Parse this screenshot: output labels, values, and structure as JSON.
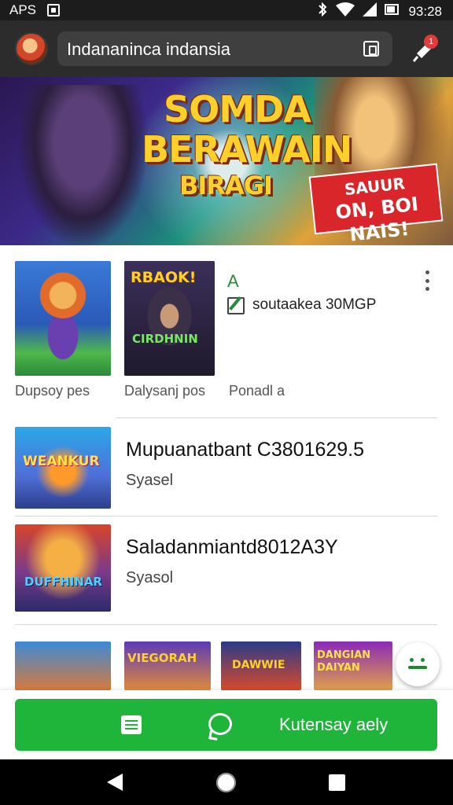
{
  "status_bar": {
    "left_text": "APS",
    "time": "93:28",
    "icons": [
      "app-notification-icon",
      "bluetooth-icon",
      "wifi-icon",
      "signal-icon",
      "battery-icon"
    ]
  },
  "header": {
    "search_text": "Indananinca indansia",
    "icons": [
      "avatar",
      "search-action-icon",
      "mic-icon"
    ],
    "notification_count": "1"
  },
  "hero_banner": {
    "title_line1": "SOMDA",
    "title_line2": "BERAWAIN",
    "title_line3": "BIRAGI",
    "tag_line1": "SAUUR",
    "tag_line2": "ON, BOI NAIS!"
  },
  "featured_grid": {
    "items": [
      {
        "caption": "Dupsoy pes",
        "art": "game-art-hero-girl"
      },
      {
        "caption": "Dalysanj pos",
        "art": "game-art-hooded-fighter",
        "art_title_top": "RBAOK!",
        "art_title_bottom": "CIRDHNIN"
      },
      {
        "caption": "Ponadl a",
        "art": ""
      }
    ],
    "side_icon_label": "A",
    "side_text": "soutaakea 30MGP"
  },
  "list_rows": [
    {
      "title": "Mupuanatbant C3801629.5",
      "subtitle": "Syasel",
      "art": "game-art-wanderer",
      "art_title": "WEANKUR"
    },
    {
      "title": "Saladanmiantd8012A3Y",
      "subtitle": "Syasol",
      "art": "game-art-defenders",
      "art_title": "DUFFHINAR"
    }
  ],
  "bottom_strip": {
    "tiles": [
      "VIEGORAH",
      "DAWWIE",
      "DANGIAN DAIYAN",
      ""
    ]
  },
  "action_bar": {
    "label": "Kutensay aely"
  },
  "colors": {
    "accent_green": "#1fb53a",
    "header_bg": "#2c2c2c",
    "badge_red": "#e23b3b"
  }
}
